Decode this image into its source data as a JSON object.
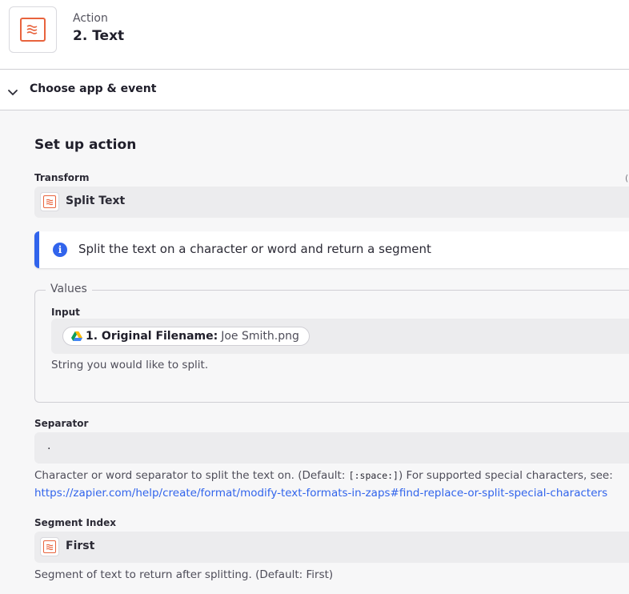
{
  "header": {
    "step_kind": "Action",
    "step_title": "2. Text",
    "app_icon": "formatter-icon"
  },
  "section": {
    "title": "Choose app & event",
    "icon": "chevron-down-icon"
  },
  "setup": {
    "title": "Set up action",
    "transform": {
      "label": "Transform",
      "trailing": "(",
      "value": "Split Text"
    },
    "info": {
      "text": "Split the text on a character or word and return a segment"
    },
    "values": {
      "legend": "Values",
      "input_label": "Input",
      "pill_key": "1. Original Filename:",
      "pill_value": "Joe Smith.png",
      "input_help": "String you would like to split."
    },
    "separator": {
      "label": "Separator",
      "value": ".",
      "help_before": "Character or word separator to split the text on. (Default: ",
      "help_code": "[:space:]",
      "help_after": ") For supported special characters, see:",
      "link": "https://zapier.com/help/create/format/modify-text-formats-in-zaps#find-replace-or-split-special-characters"
    },
    "segment": {
      "label": "Segment Index",
      "value": "First",
      "help": "Segment of text to return after splitting. (Default: First)"
    }
  },
  "colors": {
    "brand": "#e8633d",
    "accent": "#3164ec"
  }
}
